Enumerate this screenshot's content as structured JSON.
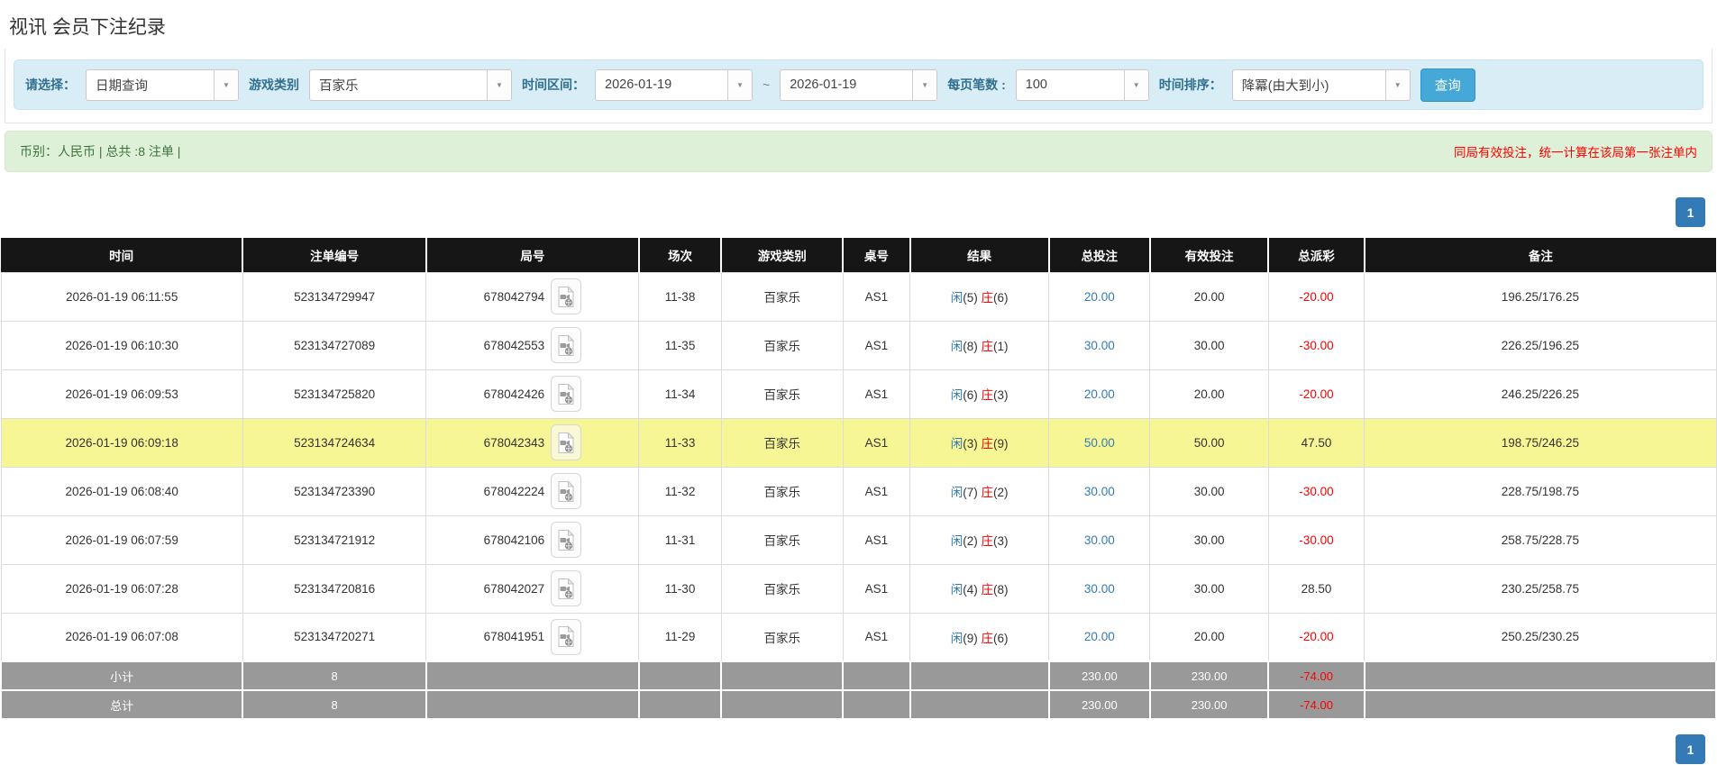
{
  "page": {
    "title": "视讯 会员下注纪录"
  },
  "colors": {
    "accent_blue": "#45a8d6",
    "pagination_blue": "#337ab7",
    "link_blue": "#337ab7",
    "negative_red": "#ff0000",
    "highlight_yellow": "#f7f694",
    "summary_gray": "#999999",
    "filter_bg": "#d9edf7",
    "filter_label": "#31708f",
    "info_bg": "#dff0d8",
    "info_text": "#3c763d",
    "header_black": "#161616"
  },
  "filters": {
    "select_label": "请选择：",
    "select_value": "日期查询",
    "game_label": "游戏类别",
    "game_value": "百家乐",
    "range_label": "时间区间：",
    "date_from": "2026-01-19",
    "tilde": "~",
    "date_to": "2026-01-19",
    "per_page_label": "每页笔数 :",
    "per_page_value": "100",
    "sort_label": "时间排序：",
    "sort_value": "降冪(由大到小)",
    "query_button": "查询"
  },
  "info_bar": {
    "summary": "币别：人民币 | 总共 :8 注单 |",
    "notice": "同局有效投注，统一计算在该局第一张注单内"
  },
  "pagination": {
    "page": "1"
  },
  "table": {
    "headers": [
      "时间",
      "注单编号",
      "局号",
      "场次",
      "游戏类别",
      "桌号",
      "结果",
      "总投注",
      "有效投注",
      "总派彩",
      "备注"
    ],
    "rows": [
      {
        "time": "2026-01-19 06:11:55",
        "bet_id": "523134729947",
        "round": "678042794",
        "session": "11-38",
        "game": "百家乐",
        "table": "AS1",
        "result": {
          "player": "闲",
          "player_score": "(5)",
          "banker": "庄",
          "banker_score": "(6)"
        },
        "total_bet": "20.00",
        "valid_bet": "20.00",
        "payout": "-20.00",
        "note": "196.25/176.25",
        "highlight": false
      },
      {
        "time": "2026-01-19 06:10:30",
        "bet_id": "523134727089",
        "round": "678042553",
        "session": "11-35",
        "game": "百家乐",
        "table": "AS1",
        "result": {
          "player": "闲",
          "player_score": "(8)",
          "banker": "庄",
          "banker_score": "(1)"
        },
        "total_bet": "30.00",
        "valid_bet": "30.00",
        "payout": "-30.00",
        "note": "226.25/196.25",
        "highlight": false
      },
      {
        "time": "2026-01-19 06:09:53",
        "bet_id": "523134725820",
        "round": "678042426",
        "session": "11-34",
        "game": "百家乐",
        "table": "AS1",
        "result": {
          "player": "闲",
          "player_score": "(6)",
          "banker": "庄",
          "banker_score": "(3)"
        },
        "total_bet": "20.00",
        "valid_bet": "20.00",
        "payout": "-20.00",
        "note": "246.25/226.25",
        "highlight": false
      },
      {
        "time": "2026-01-19 06:09:18",
        "bet_id": "523134724634",
        "round": "678042343",
        "session": "11-33",
        "game": "百家乐",
        "table": "AS1",
        "result": {
          "player": "闲",
          "player_score": "(3)",
          "banker": "庄",
          "banker_score": "(9)"
        },
        "total_bet": "50.00",
        "valid_bet": "50.00",
        "payout": "47.50",
        "note": "198.75/246.25",
        "highlight": true
      },
      {
        "time": "2026-01-19 06:08:40",
        "bet_id": "523134723390",
        "round": "678042224",
        "session": "11-32",
        "game": "百家乐",
        "table": "AS1",
        "result": {
          "player": "闲",
          "player_score": "(7)",
          "banker": "庄",
          "banker_score": "(2)"
        },
        "total_bet": "30.00",
        "valid_bet": "30.00",
        "payout": "-30.00",
        "note": "228.75/198.75",
        "highlight": false
      },
      {
        "time": "2026-01-19 06:07:59",
        "bet_id": "523134721912",
        "round": "678042106",
        "session": "11-31",
        "game": "百家乐",
        "table": "AS1",
        "result": {
          "player": "闲",
          "player_score": "(2)",
          "banker": "庄",
          "banker_score": "(3)"
        },
        "total_bet": "30.00",
        "valid_bet": "30.00",
        "payout": "-30.00",
        "note": "258.75/228.75",
        "highlight": false
      },
      {
        "time": "2026-01-19 06:07:28",
        "bet_id": "523134720816",
        "round": "678042027",
        "session": "11-30",
        "game": "百家乐",
        "table": "AS1",
        "result": {
          "player": "闲",
          "player_score": "(4)",
          "banker": "庄",
          "banker_score": "(8)"
        },
        "total_bet": "30.00",
        "valid_bet": "30.00",
        "payout": "28.50",
        "note": "230.25/258.75",
        "highlight": false
      },
      {
        "time": "2026-01-19 06:07:08",
        "bet_id": "523134720271",
        "round": "678041951",
        "session": "11-29",
        "game": "百家乐",
        "table": "AS1",
        "result": {
          "player": "闲",
          "player_score": "(9)",
          "banker": "庄",
          "banker_score": "(6)"
        },
        "total_bet": "20.00",
        "valid_bet": "20.00",
        "payout": "-20.00",
        "note": "250.25/230.25",
        "highlight": false
      }
    ],
    "subtotal": {
      "label": "小计",
      "count": "8",
      "total_bet": "230.00",
      "valid_bet": "230.00",
      "payout": "-74.00"
    },
    "grand_total": {
      "label": "总计",
      "count": "8",
      "total_bet": "230.00",
      "valid_bet": "230.00",
      "payout": "-74.00"
    }
  }
}
